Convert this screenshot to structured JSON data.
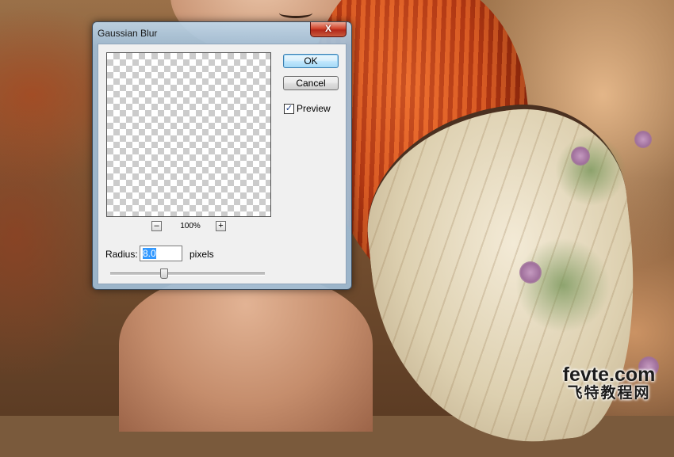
{
  "dialog": {
    "title": "Gaussian Blur",
    "close_label": "X",
    "ok_label": "OK",
    "cancel_label": "Cancel",
    "preview": {
      "label": "Preview",
      "checked": true,
      "check_glyph": "✓"
    },
    "zoom": {
      "level": "100%",
      "zoom_out_label": "–",
      "zoom_in_label": "+"
    },
    "radius": {
      "label": "Radius:",
      "value": "8.0",
      "unit": "pixels",
      "slider_fraction": 0.35
    }
  },
  "watermark": {
    "line1": "fevte.com",
    "line2": "飞特教程网"
  },
  "icons": {
    "close": "close-icon",
    "check": "checkmark-icon",
    "zoom_out": "minus-icon",
    "zoom_in": "plus-icon"
  },
  "colors": {
    "close_button": "#d2452c",
    "ok_button_border": "#3c7fb1",
    "selection": "#3399ff"
  }
}
